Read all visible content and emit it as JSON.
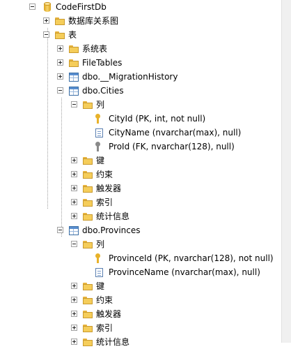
{
  "tree": {
    "database": "CodeFirstDb",
    "db_diagrams": "数据库关系图",
    "tables_folder": "表",
    "system_tables": "系统表",
    "file_tables": "FileTables",
    "migration_history": "dbo.__MigrationHistory",
    "cities": {
      "name": "dbo.Cities",
      "columns_folder": "列",
      "columns": [
        "CityId (PK, int, not null)",
        "CityName (nvarchar(max), null)",
        "ProId (FK, nvarchar(128), null)"
      ],
      "keys": "键",
      "constraints": "约束",
      "triggers": "触发器",
      "indexes": "索引",
      "statistics": "统计信息"
    },
    "provinces": {
      "name": "dbo.Provinces",
      "columns_folder": "列",
      "columns": [
        "ProvinceId (PK, nvarchar(128), not null)",
        "ProvinceName (nvarchar(max), null)"
      ],
      "keys": "键",
      "constraints": "约束",
      "triggers": "触发器",
      "indexes": "索引",
      "statistics": "统计信息"
    }
  }
}
